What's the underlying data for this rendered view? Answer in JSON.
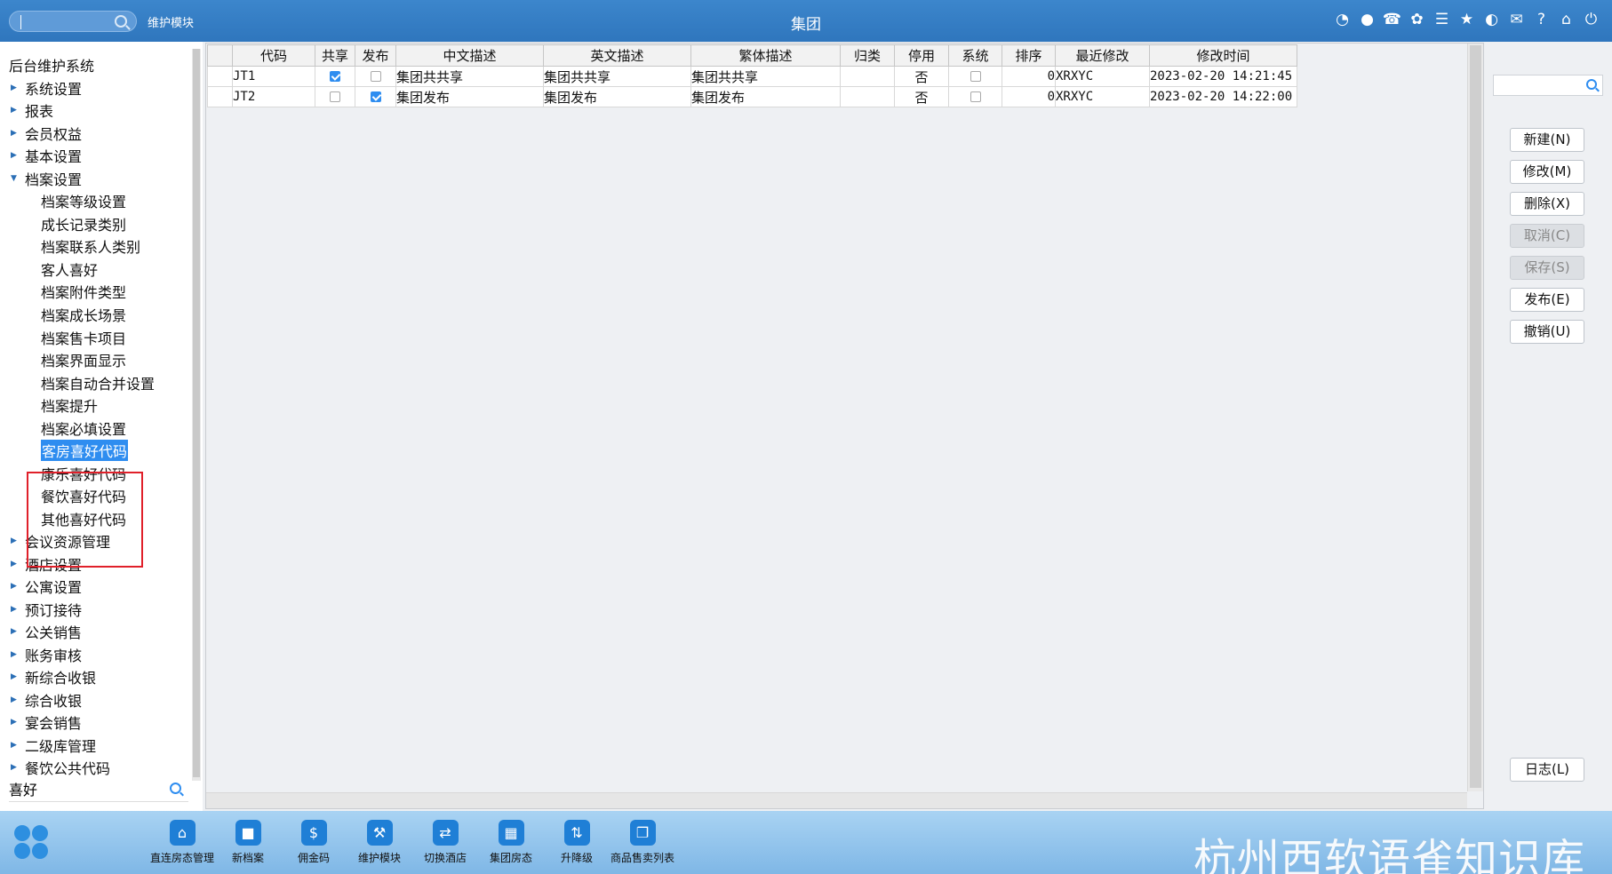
{
  "topbar": {
    "module_label": "维护模块",
    "title": "集团",
    "icons": [
      "wifi-icon",
      "message-icon",
      "phone-icon",
      "palette-icon",
      "menu-icon",
      "star-icon",
      "contrast-icon",
      "mail-icon",
      "help-icon",
      "home-icon",
      "power-icon"
    ]
  },
  "sidebar": {
    "root": "后台维护系统",
    "items": [
      {
        "label": "系统设置",
        "expanded": false
      },
      {
        "label": "报表",
        "expanded": false
      },
      {
        "label": "会员权益",
        "expanded": false
      },
      {
        "label": "基本设置",
        "expanded": false
      },
      {
        "label": "档案设置",
        "expanded": true,
        "children": [
          "档案等级设置",
          "成长记录类别",
          "档案联系人类别",
          "客人喜好",
          "档案附件类型",
          "档案成长场景",
          "档案售卡项目",
          "档案界面显示",
          "档案自动合并设置",
          "档案提升",
          "档案必填设置",
          "客房喜好代码",
          "康乐喜好代码",
          "餐饮喜好代码",
          "其他喜好代码"
        ],
        "selected_child": "客房喜好代码"
      },
      {
        "label": "会议资源管理",
        "expanded": false
      },
      {
        "label": "酒店设置",
        "expanded": false
      },
      {
        "label": "公寓设置",
        "expanded": false
      },
      {
        "label": "预订接待",
        "expanded": false
      },
      {
        "label": "公关销售",
        "expanded": false
      },
      {
        "label": "账务审核",
        "expanded": false
      },
      {
        "label": "新综合收银",
        "expanded": false
      },
      {
        "label": "综合收银",
        "expanded": false
      },
      {
        "label": "宴会销售",
        "expanded": false
      },
      {
        "label": "二级库管理",
        "expanded": false
      },
      {
        "label": "餐饮公共代码",
        "expanded": false
      }
    ],
    "search_value": "喜好"
  },
  "grid": {
    "columns": [
      "代码",
      "共享",
      "发布",
      "中文描述",
      "英文描述",
      "繁体描述",
      "归类",
      "停用",
      "系统",
      "排序",
      "最近修改",
      "修改时间"
    ],
    "rows": [
      {
        "code": "JT1",
        "share": true,
        "publish": false,
        "cn": "集团共共享",
        "en": "集团共共享",
        "tw": "集团共共享",
        "category": "",
        "disabled": "否",
        "system": false,
        "sort": "0",
        "modifier": "XRXYC",
        "time": "2023-02-20 14:21:45"
      },
      {
        "code": "JT2",
        "share": false,
        "publish": true,
        "cn": "集团发布",
        "en": "集团发布",
        "tw": "集团发布",
        "category": "",
        "disabled": "否",
        "system": false,
        "sort": "0",
        "modifier": "XRXYC",
        "time": "2023-02-20 14:22:00"
      }
    ]
  },
  "right_panel": {
    "buttons": [
      {
        "label": "新建(N)",
        "enabled": true
      },
      {
        "label": "修改(M)",
        "enabled": true
      },
      {
        "label": "删除(X)",
        "enabled": true
      },
      {
        "label": "取消(C)",
        "enabled": false
      },
      {
        "label": "保存(S)",
        "enabled": false
      },
      {
        "label": "发布(E)",
        "enabled": true
      },
      {
        "label": "撤销(U)",
        "enabled": true
      }
    ],
    "log_button": "日志(L)"
  },
  "taskbar": {
    "items": [
      {
        "label": "直连房态管理",
        "icon": "home-icon"
      },
      {
        "label": "新档案",
        "icon": "folder-icon"
      },
      {
        "label": "佣金码",
        "icon": "money-bag-icon"
      },
      {
        "label": "维护模块",
        "icon": "wrench-icon"
      },
      {
        "label": "切换酒店",
        "icon": "switch-icon"
      },
      {
        "label": "集团房态",
        "icon": "building-icon"
      },
      {
        "label": "升降级",
        "icon": "updown-icon"
      },
      {
        "label": "商品售卖列表",
        "icon": "shopping-bag-icon"
      }
    ],
    "watermark": "杭州西软语雀知识库"
  }
}
